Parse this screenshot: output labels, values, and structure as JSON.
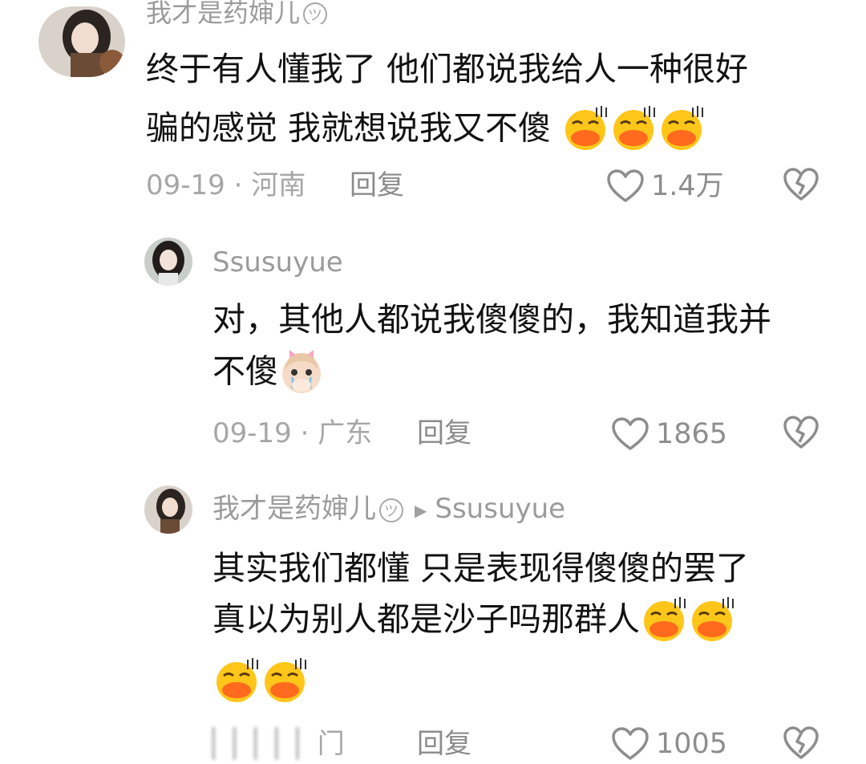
{
  "comments": [
    {
      "username": "我才是药婶儿",
      "text_line1": "终于有人懂我了 他们都说我给人一种很好",
      "text_line2": "骗的感觉 我就想说我又不傻",
      "date": "09-19",
      "location": "河南",
      "reply_label": "回复",
      "likes": "1.4万"
    },
    {
      "username": "Ssusuyue",
      "text_line1": "对，其他人都说我傻傻的，我知道我并",
      "text_line2": "不傻",
      "date": "09-19",
      "location": "广东",
      "reply_label": "回复",
      "likes": "1865"
    },
    {
      "username": "我才是药婶儿",
      "reply_to": "Ssusuyue",
      "text_line1": "其实我们都懂 只是表现得傻傻的罢了",
      "text_line2": "真以为别人都是沙子吗那群人",
      "date_partial": "门",
      "reply_label": "回复",
      "likes": "1005"
    }
  ],
  "colors": {
    "text": "#121212",
    "meta": "#a6a6a6",
    "username": "#9b9b9b",
    "emoji_face": "#ffc61a",
    "emoji_mouth": "#ff6a1e"
  },
  "icons": {
    "like": "heart-outline-icon",
    "dislike": "broken-heart-icon",
    "author_badge": "smile-badge-icon",
    "reply_arrow": "triangle-right-icon",
    "emoji_kiss": "kiss-face-emoji",
    "emoji_girl": "crying-girl-emoji"
  }
}
